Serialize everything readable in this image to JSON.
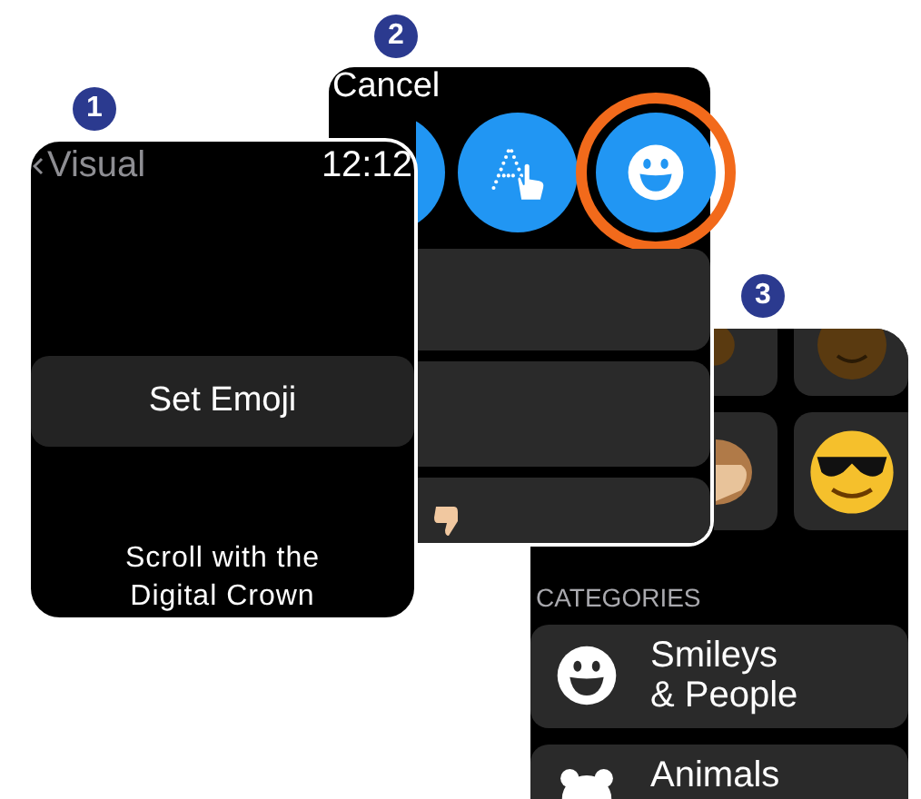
{
  "screen_1": {
    "badge": "1",
    "back_label": "Visual",
    "time": "12:12",
    "button": "Set Emoji",
    "hint": "Scroll with the Digital Crown"
  },
  "screen_2": {
    "badge": "2",
    "cancel": "Cancel",
    "input_modes": [
      {
        "kind": "plain",
        "selected": false
      },
      {
        "kind": "scribble",
        "selected": false
      },
      {
        "kind": "emoji",
        "selected": true
      }
    ]
  },
  "screen_3": {
    "badge": "3",
    "section_label": "CATEGORIES",
    "categories": [
      {
        "kind": "smileys",
        "label": "Smileys\n& People"
      },
      {
        "kind": "animals",
        "label": "Animals"
      }
    ]
  }
}
